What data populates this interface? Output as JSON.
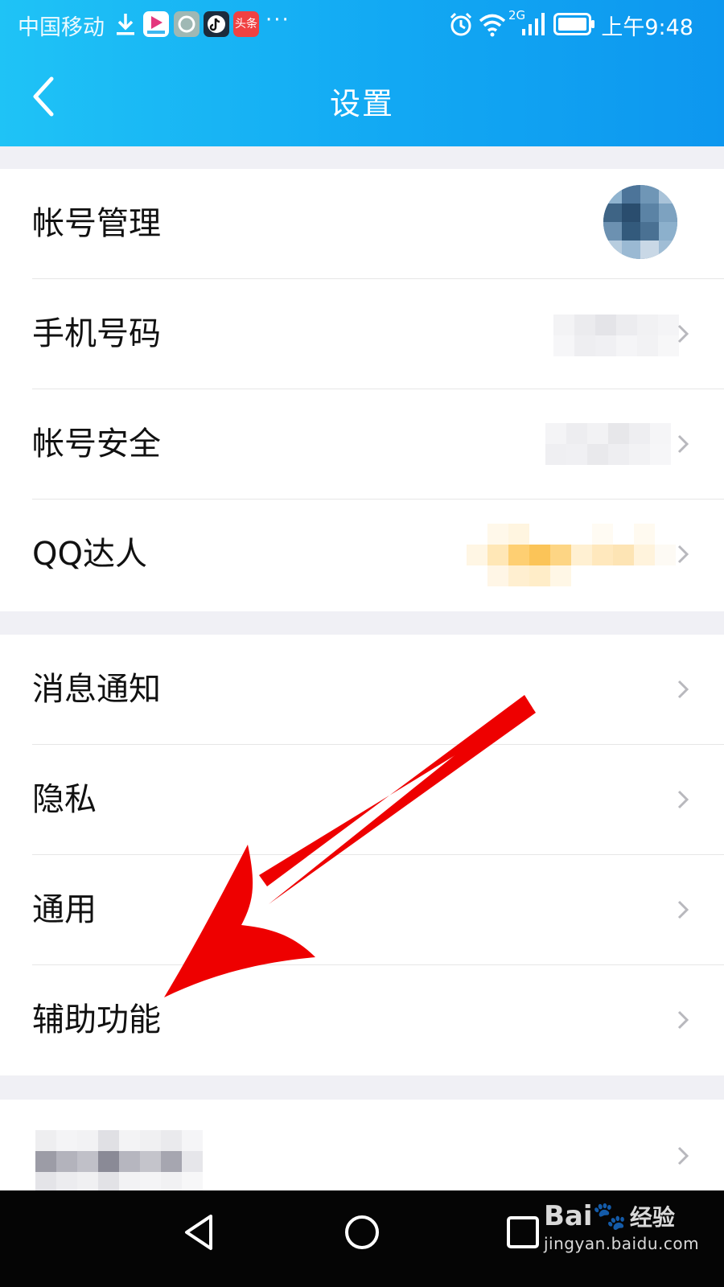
{
  "status_bar": {
    "carrier": "中国移动",
    "dots": "···",
    "network": "2G",
    "time": "上午9:48",
    "app_badge_text": "头条"
  },
  "header": {
    "title": "设置",
    "gradient_start": "#1fc3f6",
    "gradient_end": "#0d97ef"
  },
  "account_group": {
    "items": [
      {
        "label": "帐号管理",
        "trailing": "avatar-icon"
      },
      {
        "label": "手机号码",
        "trailing": "chevron-right-icon"
      },
      {
        "label": "帐号安全",
        "trailing": "chevron-right-icon"
      },
      {
        "label": "QQ达人",
        "trailing": "chevron-right-icon"
      }
    ]
  },
  "general_group": {
    "items": [
      {
        "label": "消息通知",
        "trailing": "chevron-right-icon"
      },
      {
        "label": "隐私",
        "trailing": "chevron-right-icon"
      },
      {
        "label": "通用",
        "trailing": "chevron-right-icon"
      },
      {
        "label": "辅助功能",
        "trailing": "chevron-right-icon"
      }
    ]
  },
  "bottom_group": {
    "items": [
      {
        "label": "",
        "trailing": "chevron-right-icon"
      }
    ]
  },
  "annotation": {
    "type": "red-arrow-icon",
    "color": "#ee0000",
    "points_to": "辅助功能"
  },
  "nav_bar": {
    "buttons": [
      "back-triangle-icon",
      "home-circle-icon",
      "recents-square-icon"
    ]
  },
  "watermark": {
    "logo": "Bai",
    "logo_cn": "经验",
    "url": "jingyan.baidu.com"
  }
}
